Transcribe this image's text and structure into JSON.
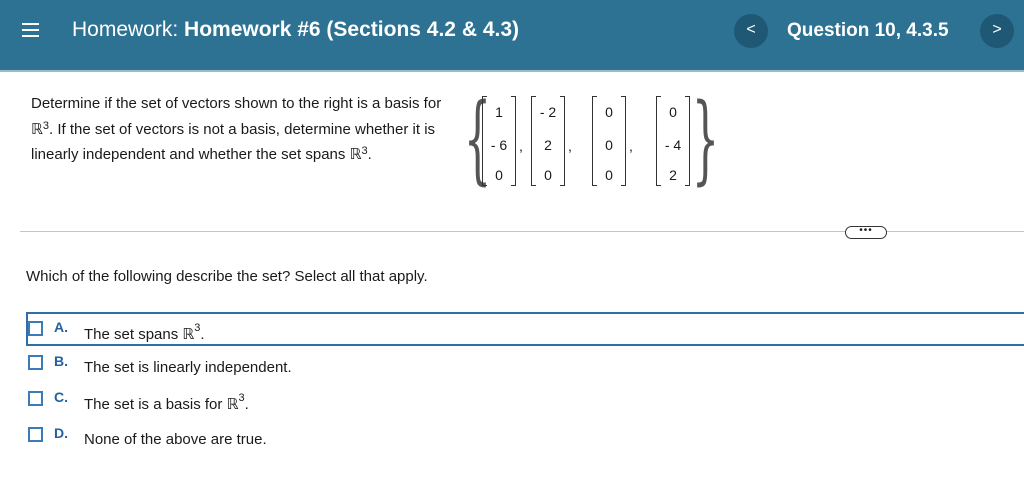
{
  "header": {
    "title_prefix": "Homework:",
    "title_main": "Homework #6 (Sections 4.2 & 4.3)",
    "question_label": "Question 10, 4.3.5",
    "prev_label": "<",
    "next_label": ">"
  },
  "problem": {
    "line_part1": "Determine if the set of vectors shown to the right is a basis for ",
    "r_symbol": "ℝ",
    "exp": "3",
    "line_part2": ". If the set of vectors is not a basis, determine whether it is linearly independent and whether the set spans ",
    "end_period": "."
  },
  "vectors": [
    [
      "1",
      "- 6",
      "0"
    ],
    [
      "- 2",
      "2",
      "0"
    ],
    [
      "0",
      "0",
      "0"
    ],
    [
      "0",
      "- 4",
      "2"
    ]
  ],
  "more_label": "•••",
  "question": "Which of the following describe the set? Select all that apply.",
  "options": [
    {
      "letter": "A.",
      "text": "The set spans ",
      "r": "ℝ",
      "exp": "3",
      "end": ".",
      "checked": false
    },
    {
      "letter": "B.",
      "text": "The set is linearly independent.",
      "checked": false
    },
    {
      "letter": "C.",
      "text": "The set is a basis for ",
      "r": "ℝ",
      "exp": "3",
      "end": ".",
      "checked": false
    },
    {
      "letter": "D.",
      "text": "None of the above are true.",
      "checked": false
    }
  ]
}
